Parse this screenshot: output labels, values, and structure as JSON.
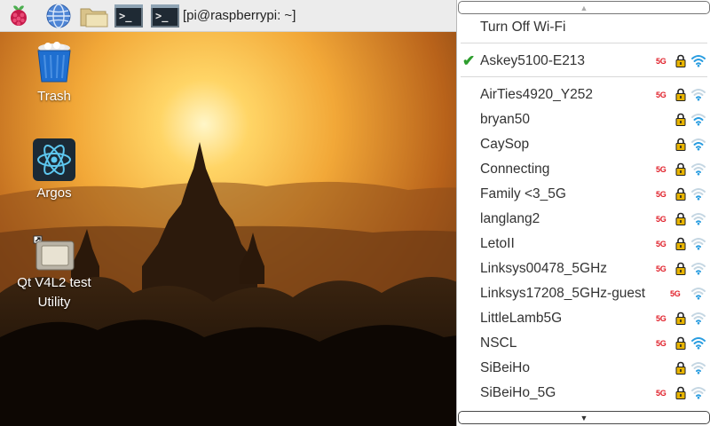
{
  "taskbar": {
    "icons": [
      "raspberry-pi-menu-icon",
      "web-browser-icon",
      "file-manager-icon",
      "terminal-icon"
    ],
    "window_label": "[pi@raspberrypi: ~]",
    "terminal_prompt": ">_",
    "bg_color": "#ececec"
  },
  "desktop": {
    "icons": [
      {
        "label": "Trash",
        "icon": "trash-icon"
      },
      {
        "label": "Argos",
        "icon": "atom-icon"
      },
      {
        "label": "Qt V4L2 test Utility",
        "icon": "camera-device-icon"
      }
    ]
  },
  "wifi_menu": {
    "turn_off": "Turn Off Wi-Fi",
    "connected": {
      "ssid": "Askey5100-E213",
      "band": "5G",
      "secured": true,
      "signal": "strong"
    },
    "networks": [
      {
        "ssid": "AirTies4920_Y252",
        "band": "5G",
        "secured": true,
        "signal": "weak"
      },
      {
        "ssid": "bryan50",
        "band": "",
        "secured": true,
        "signal": "medium"
      },
      {
        "ssid": "CaySop",
        "band": "",
        "secured": true,
        "signal": "medium"
      },
      {
        "ssid": "Connecting",
        "band": "5G",
        "secured": true,
        "signal": "weak"
      },
      {
        "ssid": "Family <3_5G",
        "band": "5G",
        "secured": true,
        "signal": "weak"
      },
      {
        "ssid": "langlang2",
        "band": "5G",
        "secured": true,
        "signal": "weak"
      },
      {
        "ssid": "LetoII",
        "band": "5G",
        "secured": true,
        "signal": "weak"
      },
      {
        "ssid": "Linksys00478_5GHz",
        "band": "5G",
        "secured": true,
        "signal": "weak"
      },
      {
        "ssid": "Linksys17208_5GHz-guest",
        "band": "5G",
        "secured": false,
        "signal": "weak"
      },
      {
        "ssid": "LittleLamb5G",
        "band": "5G",
        "secured": true,
        "signal": "weak"
      },
      {
        "ssid": "NSCL",
        "band": "5G",
        "secured": true,
        "signal": "strong"
      },
      {
        "ssid": "SiBeiHo",
        "band": "",
        "secured": true,
        "signal": "weak"
      },
      {
        "ssid": "SiBeiHo_5G",
        "band": "5G",
        "secured": true,
        "signal": "weak"
      }
    ],
    "colors": {
      "band": "#e0202a",
      "lock": "#e8b400",
      "signal": "#2a9de0",
      "signal_dim": "#c4d6e2",
      "check": "#2e9e2e"
    }
  }
}
